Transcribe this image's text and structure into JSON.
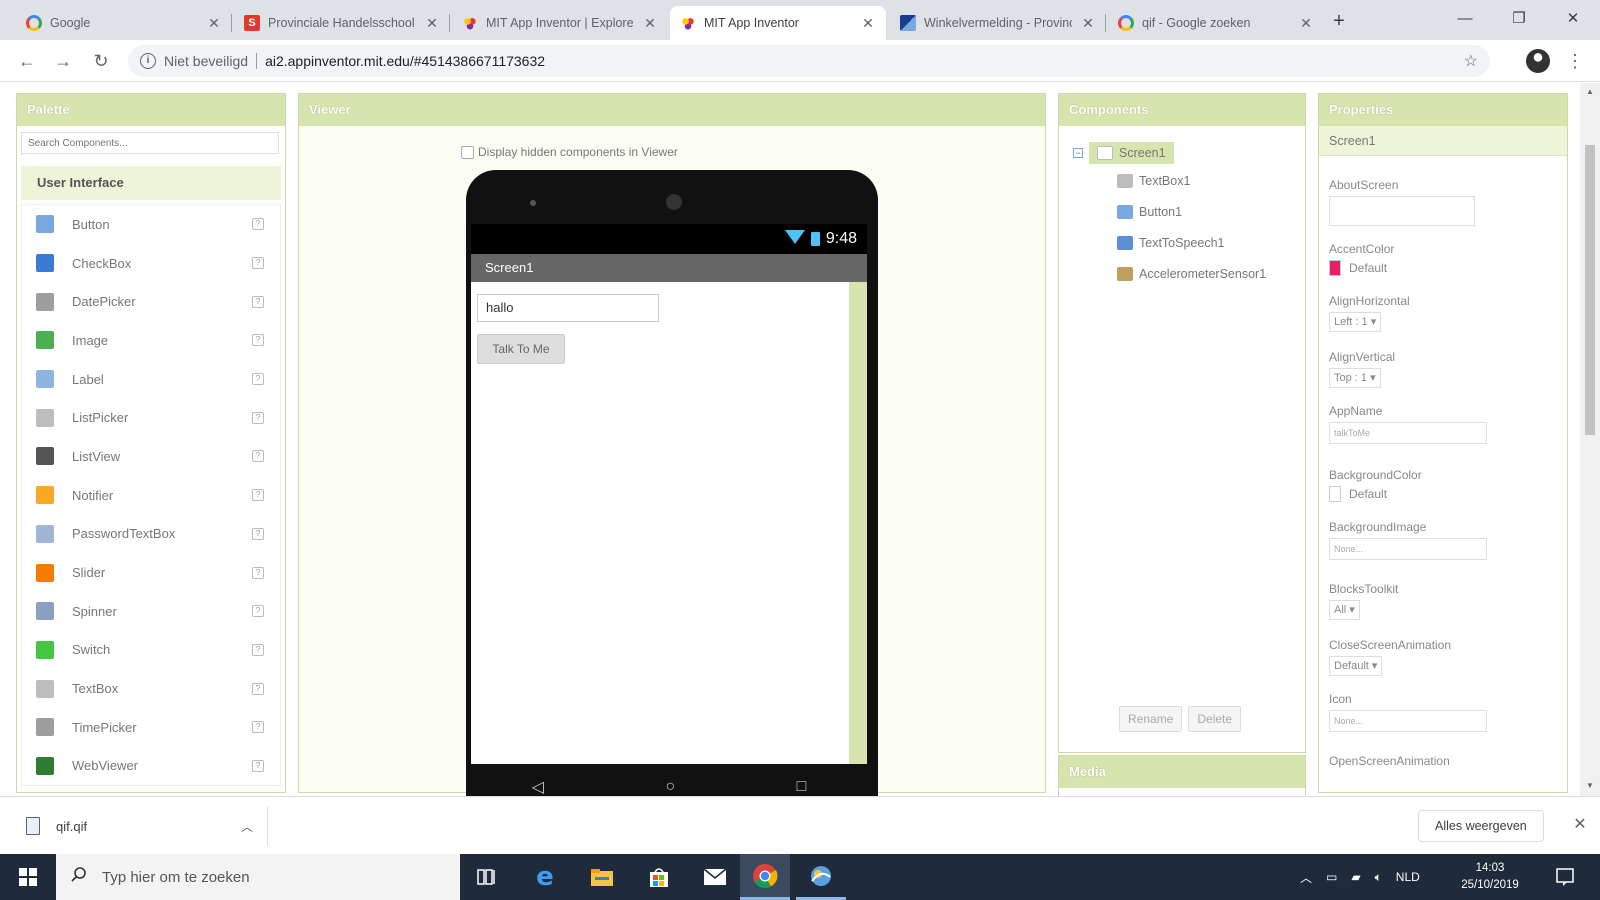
{
  "browser": {
    "tabs": [
      {
        "title": "Google",
        "favicon": "google-icon",
        "active": false
      },
      {
        "title": "Provinciale Handelsschool",
        "favicon": "site-s-icon",
        "active": false
      },
      {
        "title": "MIT App Inventor | Explore",
        "favicon": "app-inventor-icon",
        "active": false
      },
      {
        "title": "MIT App Inventor",
        "favicon": "app-inventor-icon",
        "active": true
      },
      {
        "title": "Winkelvermelding - Provincie",
        "favicon": "flag-icon",
        "active": false
      },
      {
        "title": "qif - Google zoeken",
        "favicon": "google-icon",
        "active": false
      }
    ],
    "new_tab_label": "+",
    "window_controls": {
      "minimize": "—",
      "restore": "❐",
      "close": "✕"
    },
    "address": {
      "security_label": "Niet beveiligd",
      "url": "ai2.appinventor.mit.edu/#4514386671173632"
    }
  },
  "palette": {
    "title": "Palette",
    "search_placeholder": "Search Components...",
    "category": "User Interface",
    "items": [
      {
        "label": "Button",
        "icon": "button-icon",
        "color": "#7aa7e0"
      },
      {
        "label": "CheckBox",
        "icon": "checkbox-icon",
        "color": "#3a7bd5"
      },
      {
        "label": "DatePicker",
        "icon": "datepicker-icon",
        "color": "#9e9e9e"
      },
      {
        "label": "Image",
        "icon": "image-icon",
        "color": "#4caf50"
      },
      {
        "label": "Label",
        "icon": "label-icon",
        "color": "#90b4e0"
      },
      {
        "label": "ListPicker",
        "icon": "listpicker-icon",
        "color": "#bdbdbd"
      },
      {
        "label": "ListView",
        "icon": "listview-icon",
        "color": "#555555"
      },
      {
        "label": "Notifier",
        "icon": "notifier-icon",
        "color": "#f9a825"
      },
      {
        "label": "PasswordTextBox",
        "icon": "password-icon",
        "color": "#9fb6d6"
      },
      {
        "label": "Slider",
        "icon": "slider-icon",
        "color": "#f57c00"
      },
      {
        "label": "Spinner",
        "icon": "spinner-icon",
        "color": "#8aa0c0"
      },
      {
        "label": "Switch",
        "icon": "switch-icon",
        "color": "#43c743"
      },
      {
        "label": "TextBox",
        "icon": "textbox-icon",
        "color": "#bdbdbd"
      },
      {
        "label": "TimePicker",
        "icon": "timepicker-icon",
        "color": "#9e9e9e"
      },
      {
        "label": "WebViewer",
        "icon": "webviewer-icon",
        "color": "#2e7d32"
      }
    ]
  },
  "viewer": {
    "title": "Viewer",
    "hidden_checkbox_label": "Display hidden components in Viewer",
    "phone": {
      "time": "9:48",
      "screen_title": "Screen1",
      "textbox_value": "hallo",
      "button_label": "Talk To Me"
    }
  },
  "components": {
    "title": "Components",
    "root": "Screen1",
    "children": [
      {
        "label": "TextBox1",
        "icon": "textbox-icon",
        "color": "#bdbdbd"
      },
      {
        "label": "Button1",
        "icon": "button-icon",
        "color": "#7aa7e0"
      },
      {
        "label": "TextToSpeech1",
        "icon": "speech-icon",
        "color": "#5c8fd6"
      },
      {
        "label": "AccelerometerSensor1",
        "icon": "accelerometer-icon",
        "color": "#c0a060"
      }
    ],
    "rename_label": "Rename",
    "delete_label": "Delete",
    "media_title": "Media"
  },
  "properties": {
    "title": "Properties",
    "component": "Screen1",
    "about_screen_label": "AboutScreen",
    "accent_color_label": "AccentColor",
    "accent_color_value": "Default",
    "accent_color_swatch": "#e91e63",
    "align_horizontal_label": "AlignHorizontal",
    "align_horizontal_value": "Left : 1 ▾",
    "align_vertical_label": "AlignVertical",
    "align_vertical_value": "Top : 1 ▾",
    "app_name_label": "AppName",
    "app_name_value": "talkToMe",
    "background_color_label": "BackgroundColor",
    "background_color_value": "Default",
    "background_image_label": "BackgroundImage",
    "background_image_value": "None...",
    "blocks_toolkit_label": "BlocksToolkit",
    "blocks_toolkit_value": "All ▾",
    "close_screen_animation_label": "CloseScreenAnimation",
    "close_screen_animation_value": "Default ▾",
    "icon_label": "Icon",
    "icon_value": "None...",
    "open_screen_animation_label": "OpenScreenAnimation"
  },
  "download_bar": {
    "file_name": "qif.qif",
    "show_all_label": "Alles weergeven"
  },
  "taskbar": {
    "search_placeholder": "Typ hier om te zoeken",
    "language": "NLD",
    "time": "14:03",
    "date": "25/10/2019"
  }
}
